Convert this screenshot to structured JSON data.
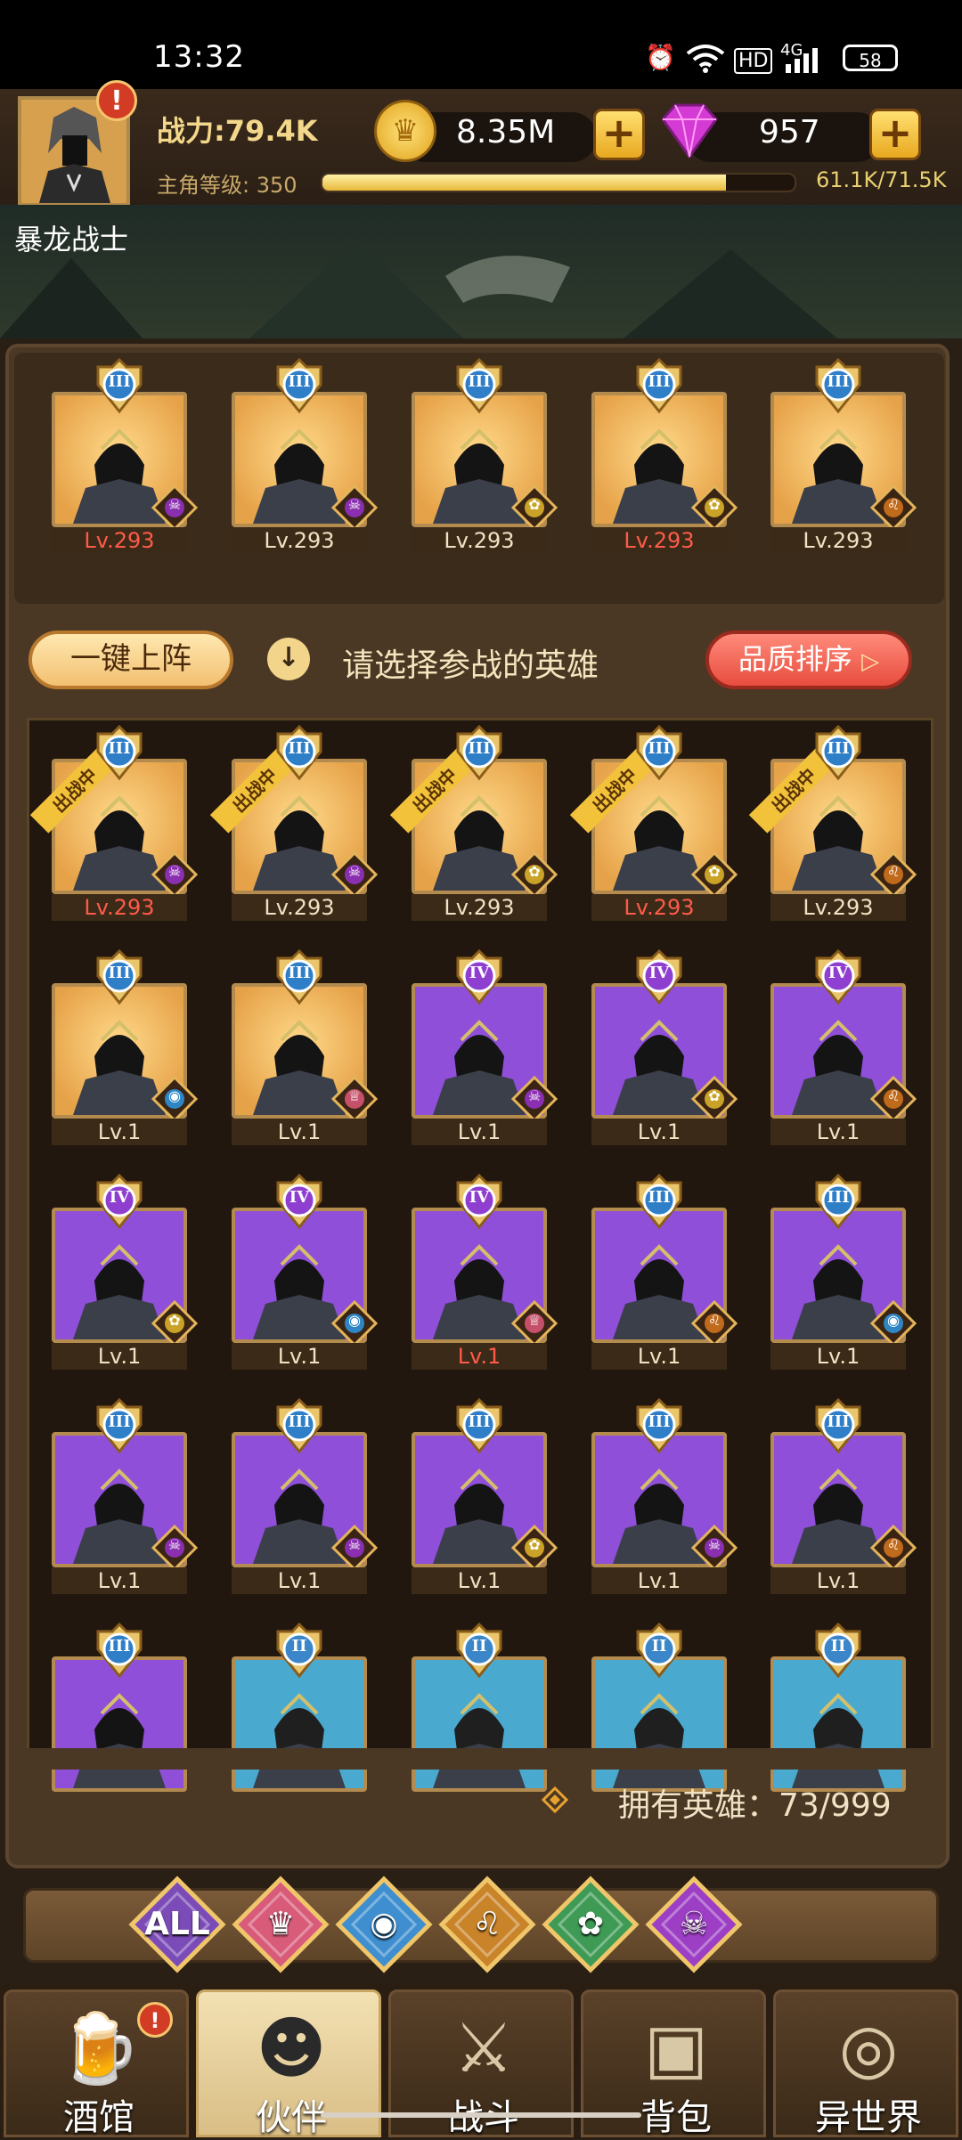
{
  "status_bar": {
    "time": "13:32",
    "battery": "58",
    "hd": "HD",
    "network": "4G"
  },
  "player": {
    "power_label": "战力:79.4K",
    "level_label": "主角等级: 350",
    "xp_text": "61.1K/71.5K",
    "xp_fraction": 0.854,
    "alert": "!"
  },
  "currency": {
    "gold": "8.35M",
    "gems": "957",
    "plus": "+"
  },
  "banner_text": "暴龙战士",
  "lineup": [
    {
      "lv": "Lv.293",
      "red": true,
      "race": "demon",
      "rank": "III",
      "tier": "gold"
    },
    {
      "lv": "Lv.293",
      "red": false,
      "race": "demon",
      "rank": "III",
      "tier": "gold"
    },
    {
      "lv": "Lv.293",
      "red": false,
      "race": "elf",
      "rank": "III",
      "tier": "gold"
    },
    {
      "lv": "Lv.293",
      "red": true,
      "race": "elf",
      "rank": "III",
      "tier": "gold"
    },
    {
      "lv": "Lv.293",
      "red": false,
      "race": "beast",
      "rank": "III",
      "tier": "gold"
    }
  ],
  "actions": {
    "quick_deploy": "一键上阵",
    "hint": "请选择参战的英雄",
    "sort": "品质排序",
    "hint_icon": "↓"
  },
  "heroes": [
    {
      "lv": "Lv.293",
      "red": true,
      "race": "demon",
      "rank": "III",
      "tier": "gold",
      "tag": "出战中"
    },
    {
      "lv": "Lv.293",
      "red": false,
      "race": "demon",
      "rank": "III",
      "tier": "gold",
      "tag": "出战中"
    },
    {
      "lv": "Lv.293",
      "red": false,
      "race": "elf",
      "rank": "III",
      "tier": "gold",
      "tag": "出战中"
    },
    {
      "lv": "Lv.293",
      "red": true,
      "race": "elf",
      "rank": "III",
      "tier": "gold",
      "tag": "出战中"
    },
    {
      "lv": "Lv.293",
      "red": false,
      "race": "beast",
      "rank": "III",
      "tier": "gold",
      "tag": "出战中"
    },
    {
      "lv": "Lv.1",
      "red": false,
      "race": "goblin",
      "rank": "III",
      "tier": "gold",
      "tag": ""
    },
    {
      "lv": "Lv.1",
      "red": false,
      "race": "human",
      "rank": "III",
      "tier": "gold",
      "tag": ""
    },
    {
      "lv": "Lv.1",
      "red": false,
      "race": "demon",
      "rank": "IV",
      "tier": "purple",
      "tag": ""
    },
    {
      "lv": "Lv.1",
      "red": false,
      "race": "elf",
      "rank": "IV",
      "tier": "purple",
      "tag": ""
    },
    {
      "lv": "Lv.1",
      "red": false,
      "race": "beast",
      "rank": "IV",
      "tier": "purple",
      "tag": ""
    },
    {
      "lv": "Lv.1",
      "red": false,
      "race": "elf",
      "rank": "IV",
      "tier": "purple",
      "tag": ""
    },
    {
      "lv": "Lv.1",
      "red": false,
      "race": "goblin",
      "rank": "IV",
      "tier": "purple",
      "tag": ""
    },
    {
      "lv": "Lv.1",
      "red": true,
      "race": "human",
      "rank": "IV",
      "tier": "purple",
      "tag": ""
    },
    {
      "lv": "Lv.1",
      "red": false,
      "race": "beast",
      "rank": "III",
      "tier": "purple",
      "tag": ""
    },
    {
      "lv": "Lv.1",
      "red": false,
      "race": "goblin",
      "rank": "III",
      "tier": "purple",
      "tag": ""
    },
    {
      "lv": "Lv.1",
      "red": false,
      "race": "demon",
      "rank": "III",
      "tier": "purple",
      "tag": ""
    },
    {
      "lv": "Lv.1",
      "red": false,
      "race": "demon",
      "rank": "III",
      "tier": "purple",
      "tag": ""
    },
    {
      "lv": "Lv.1",
      "red": false,
      "race": "elf",
      "rank": "III",
      "tier": "purple",
      "tag": ""
    },
    {
      "lv": "Lv.1",
      "red": false,
      "race": "demon",
      "rank": "III",
      "tier": "purple",
      "tag": ""
    },
    {
      "lv": "Lv.1",
      "red": false,
      "race": "beast",
      "rank": "III",
      "tier": "purple",
      "tag": ""
    },
    {
      "lv": "",
      "red": false,
      "race": "",
      "rank": "III",
      "tier": "purple",
      "tag": ""
    },
    {
      "lv": "",
      "red": false,
      "race": "",
      "rank": "II",
      "tier": "blue",
      "tag": ""
    },
    {
      "lv": "",
      "red": false,
      "race": "",
      "rank": "II",
      "tier": "blue",
      "tag": ""
    },
    {
      "lv": "",
      "red": false,
      "race": "",
      "rank": "II",
      "tier": "blue",
      "tag": ""
    },
    {
      "lv": "",
      "red": false,
      "race": "",
      "rank": "II",
      "tier": "blue",
      "tag": ""
    }
  ],
  "owned_text": "拥有英雄：73/999",
  "filters": [
    {
      "label": "ALL",
      "icon": "all-icon",
      "color": "#7b4bb8"
    },
    {
      "label": "",
      "icon": "human-race-icon",
      "color": "#d95b7a"
    },
    {
      "label": "",
      "icon": "goblin-race-icon",
      "color": "#3f8fd0"
    },
    {
      "label": "",
      "icon": "beast-race-icon",
      "color": "#c9842a"
    },
    {
      "label": "",
      "icon": "elf-race-icon",
      "color": "#3e9a54"
    },
    {
      "label": "",
      "icon": "demon-race-icon",
      "color": "#9c3fc4"
    }
  ],
  "nav": [
    {
      "label": "酒馆",
      "icon": "tavern-mug-icon",
      "active": false
    },
    {
      "label": "伙伴",
      "icon": "partner-icon",
      "active": true
    },
    {
      "label": "战斗",
      "icon": "battle-swords-icon",
      "active": false
    },
    {
      "label": "背包",
      "icon": "backpack-icon",
      "active": false
    },
    {
      "label": "异世界",
      "icon": "portal-icon",
      "active": false
    }
  ],
  "colors": {
    "gold_tier": "#e6a248",
    "purple_tier": "#8f4fd9",
    "blue_tier": "#4aa9cf",
    "accent_red": "#e74d3e",
    "xp_fill": "#e8b93b"
  }
}
